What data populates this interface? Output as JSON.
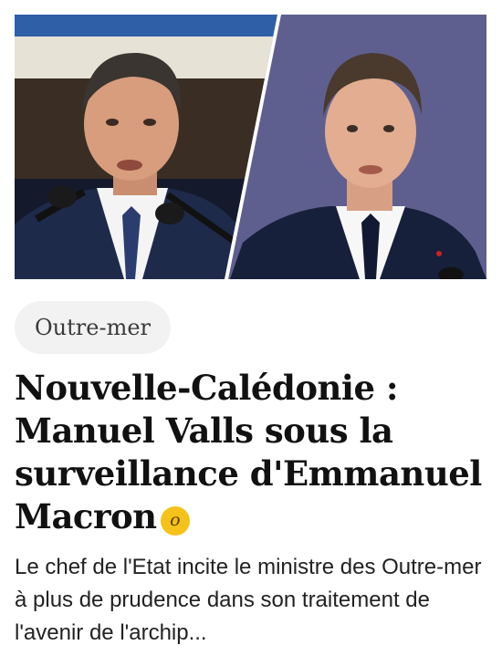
{
  "article": {
    "category": "Outre-mer",
    "title": "Nouvelle-Calédonie : Manuel Valls sous la surveillance d'Emmanuel Macron",
    "premium_badge_letter": "o",
    "summary": "Le chef de l'Etat incite le ministre des Outre-mer à plus de prudence dans son traitement de l'avenir de l'archip...",
    "image": {
      "description_icon": "photo-icon"
    }
  },
  "colors": {
    "premium_badge": "#f5c21b",
    "chip_background": "#f2f2f2",
    "headline": "#111111"
  }
}
